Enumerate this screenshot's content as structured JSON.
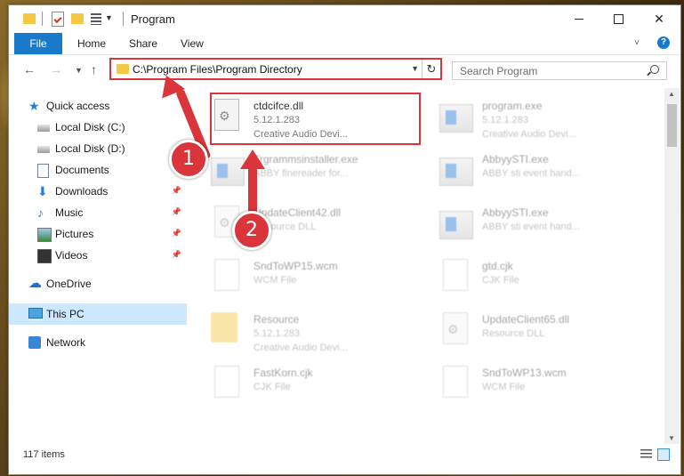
{
  "window": {
    "title": "Program",
    "status": "117 items"
  },
  "ribbon": {
    "tabs": [
      "File",
      "Home",
      "Share",
      "View"
    ]
  },
  "address": {
    "path": "C:\\Program Files\\Program Directory",
    "search_placeholder": "Search Program"
  },
  "sidebar": {
    "items": [
      {
        "label": "Quick access",
        "icon": "star-icon",
        "pinned": false
      },
      {
        "label": "Local Disk (C:)",
        "icon": "drive-icon",
        "pinned": false
      },
      {
        "label": "Local Disk (D:)",
        "icon": "drive-icon",
        "pinned": false
      },
      {
        "label": "Documents",
        "icon": "documents-icon",
        "pinned": false
      },
      {
        "label": "Downloads",
        "icon": "download-icon",
        "pinned": true
      },
      {
        "label": "Music",
        "icon": "music-icon",
        "pinned": true
      },
      {
        "label": "Pictures",
        "icon": "pictures-icon",
        "pinned": true
      },
      {
        "label": "Videos",
        "icon": "videos-icon",
        "pinned": true
      },
      {
        "label": "OneDrive",
        "icon": "cloud-icon",
        "pinned": false
      },
      {
        "label": "This PC",
        "icon": "computer-icon",
        "pinned": false
      },
      {
        "label": "Network",
        "icon": "network-icon",
        "pinned": false
      }
    ]
  },
  "files": [
    {
      "name": "ctdcifce.dll",
      "line2": "5.12.1.283",
      "line3": "Creative Audio Devi...",
      "icon": "dll-icon"
    },
    {
      "name": "program.exe",
      "line2": "5.12.1.283",
      "line3": "Creative Audio Devi...",
      "icon": "exe-icon"
    },
    {
      "name": "Trgrammsinstaller.exe",
      "line2": "ABBY finereader for...",
      "line3": "",
      "icon": "exe-icon"
    },
    {
      "name": "AbbyySTI.exe",
      "line2": "ABBY sti event hand...",
      "line3": "",
      "icon": "exe-icon"
    },
    {
      "name": "UpdateClient42.dll",
      "line2": "Resource DLL",
      "line3": "",
      "icon": "dll-icon"
    },
    {
      "name": "AbbyySTI.exe",
      "line2": "ABBY sti event hand...",
      "line3": "",
      "icon": "exe-icon"
    },
    {
      "name": "SndToWP15.wcm",
      "line2": "WCM File",
      "line3": "",
      "icon": "file-icon"
    },
    {
      "name": "gtd.cjk",
      "line2": "CJK File",
      "line3": "",
      "icon": "file-icon"
    },
    {
      "name": "Resource",
      "line2": "5.12.1.283",
      "line3": "Creative Audio Devi...",
      "icon": "folder-icon"
    },
    {
      "name": "UpdateClient65.dll",
      "line2": "Resource DLL",
      "line3": "",
      "icon": "dll-icon"
    },
    {
      "name": "FastKorn.cjk",
      "line2": "CJK File",
      "line3": "",
      "icon": "file-icon"
    },
    {
      "name": "SndToWP13.wcm",
      "line2": "WCM File",
      "line3": "",
      "icon": "file-icon"
    }
  ],
  "annotations": [
    "1",
    "2"
  ],
  "colors": {
    "accent": "#1979ca",
    "highlight": "#d9353a"
  }
}
